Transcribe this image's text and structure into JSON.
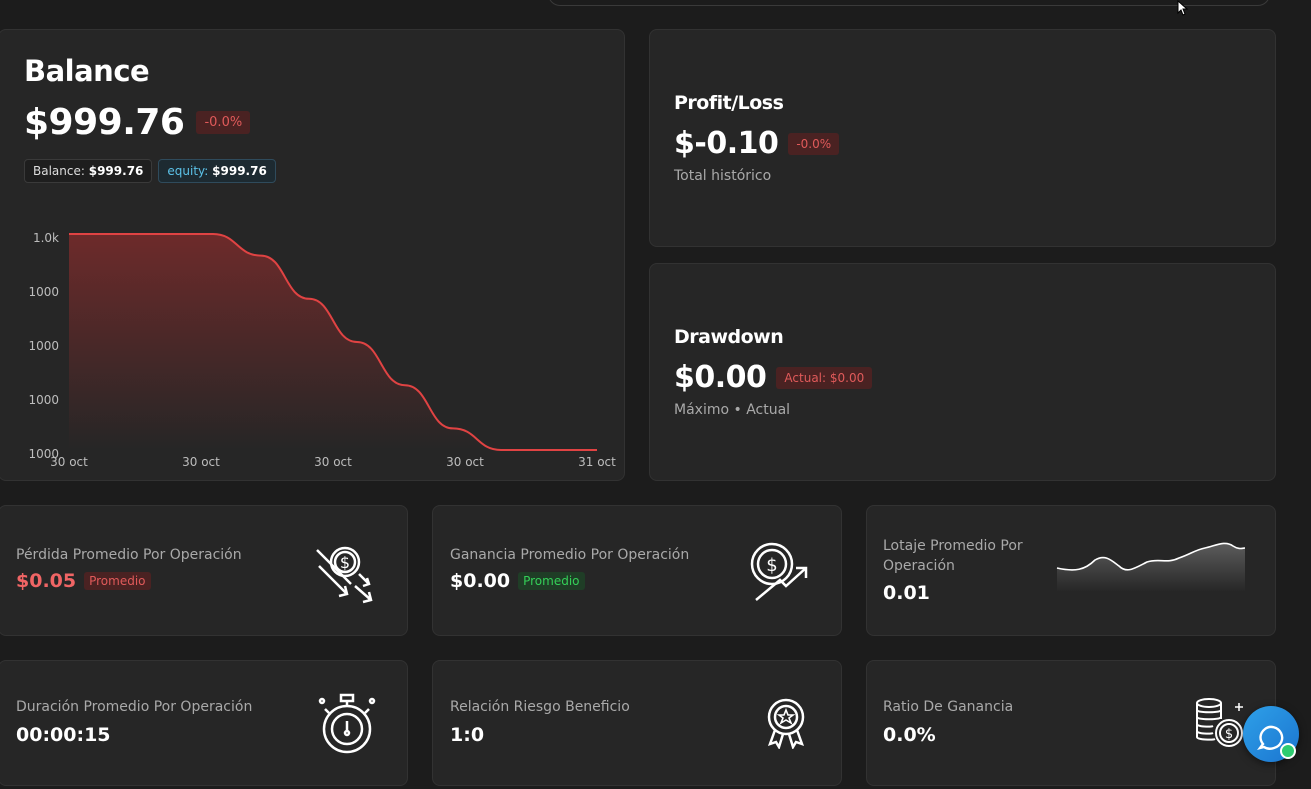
{
  "balance": {
    "title": "Balance",
    "amount": "$999.76",
    "change": "-0.0%",
    "balance_label": "Balance:",
    "balance_value": "$999.76",
    "equity_label": "equity:",
    "equity_value": "$999.76"
  },
  "chart_data": {
    "type": "area",
    "x": [
      "30 oct",
      "30 oct",
      "30 oct",
      "30 oct",
      "31 oct"
    ],
    "y_ticks": [
      "1.0k",
      "1000",
      "1000",
      "1000",
      "1000"
    ],
    "series": [
      {
        "values": [
          999.86,
          999.86,
          999.86,
          999.86,
          999.85,
          999.83,
          999.81,
          999.79,
          999.77,
          999.76,
          999.76,
          999.76
        ]
      }
    ],
    "ylim": [
      999.76,
      999.86
    ],
    "line_color": "#e04343",
    "fill_color": "#7a2b2b"
  },
  "profit_loss": {
    "title": "Profit/Loss",
    "amount": "$-0.10",
    "change": "-0.0%",
    "subtitle": "Total histórico"
  },
  "drawdown": {
    "title": "Drawdown",
    "amount": "$0.00",
    "badge": "Actual: $0.00",
    "subtitle": "Máximo • Actual"
  },
  "stats": [
    {
      "label": "Pérdida Promedio Por Operación",
      "value": "$0.05",
      "badge": "Promedio",
      "value_color": "#f06565",
      "icon": "money-down-icon"
    },
    {
      "label": "Ganancia Promedio Por Operación",
      "value": "$0.00",
      "badge": "Promedio",
      "value_color": "#ffffff",
      "icon": "money-up-icon"
    },
    {
      "label": "Lotaje Promedio Por Operación",
      "value": "0.01",
      "icon": "sparkline-icon"
    },
    {
      "label": "Duración Promedio Por Operación",
      "value": "00:00:15",
      "icon": "stopwatch-icon"
    },
    {
      "label": "Relación Riesgo Beneficio",
      "value": "1:0",
      "icon": "award-icon"
    },
    {
      "label": "Ratio De Ganancia",
      "value": "0.0%",
      "icon": "coins-icon"
    }
  ],
  "colors": {
    "accent_red": "#e05a5a",
    "accent_green": "#34d058",
    "accent_blue": "#5cc2e8",
    "chat": "#1b8ae0"
  }
}
